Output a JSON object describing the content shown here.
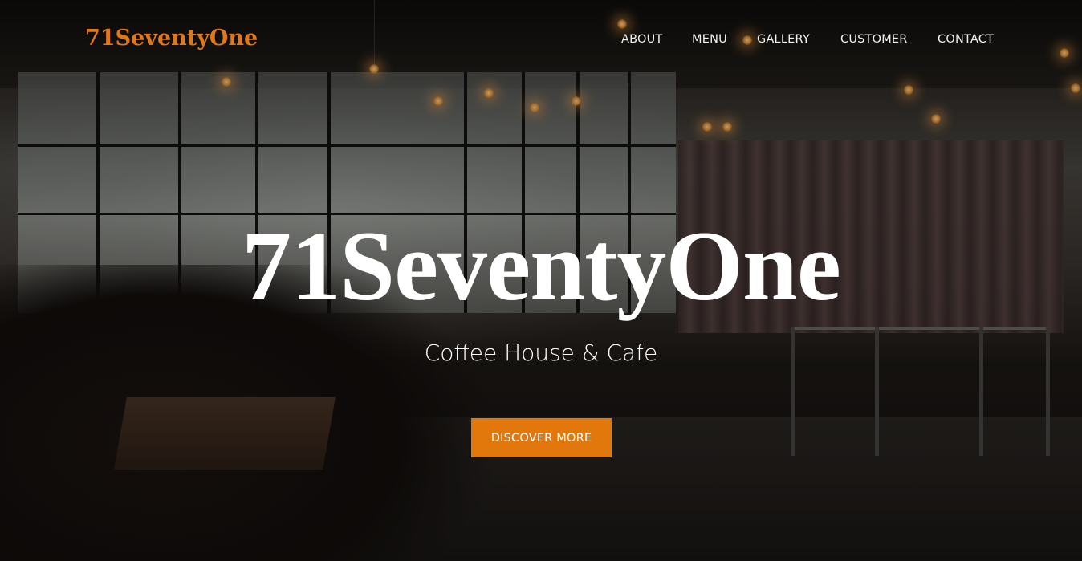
{
  "brand": {
    "logo_text": "71SeventyOne",
    "accent_color": "#e2770c"
  },
  "nav": {
    "items": [
      {
        "label": "ABOUT"
      },
      {
        "label": "MENU"
      },
      {
        "label": "GALLERY"
      },
      {
        "label": "CUSTOMER"
      },
      {
        "label": "CONTACT"
      }
    ]
  },
  "hero": {
    "title": "71SeventyOne",
    "subtitle": "Coffee House & Cafe",
    "cta_label": "DISCOVER MORE"
  }
}
